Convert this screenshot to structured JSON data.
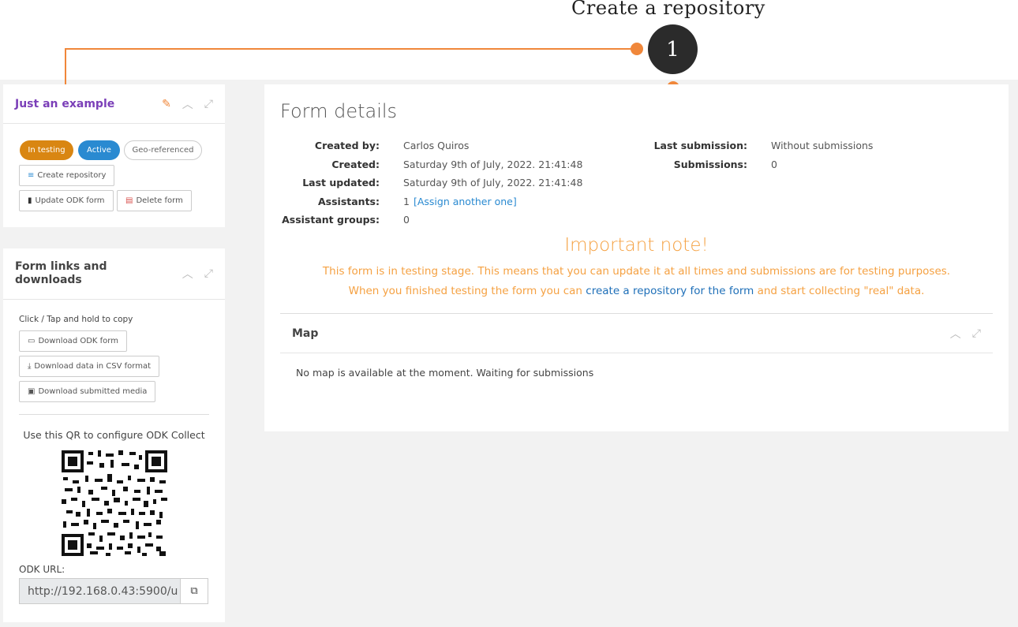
{
  "callout": {
    "title": "Create a repository",
    "number": "1"
  },
  "form_card": {
    "title": "Just an example",
    "badges": {
      "testing": "In testing",
      "active": "Active",
      "geo": "Geo-referenced"
    },
    "create_repo": "Create repository",
    "update_form": "Update ODK form",
    "delete_form": "Delete form"
  },
  "links_card": {
    "title_line1": "Form links and",
    "title_line2": "downloads",
    "hint": "Click / Tap and hold to copy",
    "download_odk": "Download ODK form",
    "download_csv": "Download data in CSV format",
    "download_media": "Download submitted media",
    "qr_text": "Use this QR to configure ODK Collect",
    "url_label": "ODK URL:",
    "url_value": "http://192.168.0.43:5900/u"
  },
  "details": {
    "title": "Form details",
    "created_by_label": "Created by:",
    "created_by": "Carlos Quiros",
    "created_label": "Created:",
    "created": "Saturday 9th of July, 2022. 21:41:48",
    "updated_label": "Last updated:",
    "updated": "Saturday 9th of July, 2022. 21:41:48",
    "assistants_label": "Assistants:",
    "assistants_count": "1",
    "assistants_link": "[Assign another one]",
    "groups_label": "Assistant groups:",
    "groups": "0",
    "last_sub_label": "Last submission:",
    "last_sub": "Without submissions",
    "subs_label": "Submissions:",
    "subs": "0"
  },
  "note": {
    "title": "Important note!",
    "line1": "This form is in testing stage. This means that you can update it at all times and submissions are for testing purposes.",
    "line2_pre": "When you finished testing the form you can ",
    "line2_link": "create a repository for the form",
    "line2_post": " and start collecting \"real\" data."
  },
  "map": {
    "title": "Map",
    "message": "No map is available at the moment. Waiting for submissions"
  },
  "colors": {
    "accent_orange": "#f0873a",
    "testing": "#d98612",
    "active": "#2a8ad1",
    "title_purple": "#7b3fb8",
    "note": "#f5a142"
  }
}
